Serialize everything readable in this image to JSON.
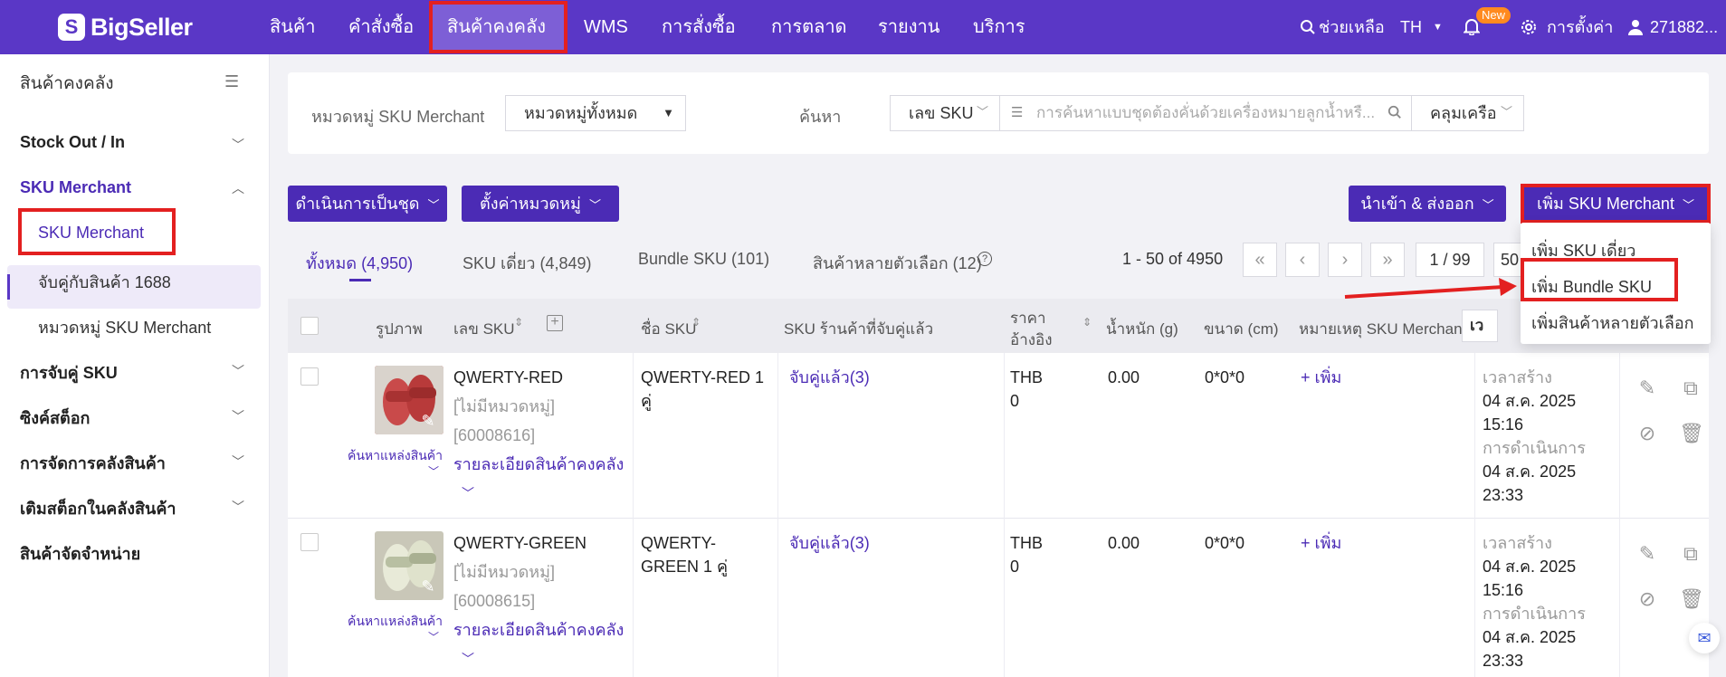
{
  "brand": {
    "name": "BigSeller",
    "mark": "S"
  },
  "topnav": {
    "items": [
      "สินค้า",
      "คำสั่งซื้อ",
      "สินค้าคงคลัง",
      "WMS",
      "การสั่งซื้อ",
      "การตลาด",
      "รายงาน",
      "บริการ"
    ],
    "active": "สินค้าคงคลัง"
  },
  "topright": {
    "help": "ช่วยเหลือ",
    "lang": "TH",
    "badge": "New",
    "settings": "การตั้งค่า",
    "user": "271882..."
  },
  "sidebar": {
    "title": "สินค้าคงคลัง",
    "groups": [
      {
        "label": "Stock Out / In"
      },
      {
        "label": "SKU Merchant"
      },
      {
        "label": "การจับคู่ SKU"
      },
      {
        "label": "ซิงค์สต็อก"
      },
      {
        "label": "การจัดการคลังสินค้า"
      },
      {
        "label": "เติมสต็อกในคลังสินค้า"
      },
      {
        "label": "สินค้าจัดจำหน่าย"
      }
    ],
    "subitems": [
      "SKU Merchant",
      "จับคู่กับสินค้า 1688",
      "หมวดหมู่ SKU Merchant"
    ]
  },
  "filters": {
    "category_label": "หมวดหมู่ SKU Merchant",
    "category_value": "หมวดหมู่ทั้งหมด",
    "search_label": "ค้นหา",
    "search_field": "เลข SKU",
    "search_placeholder": "การค้นหาแบบชุดต้องคั่นด้วยเครื่องหมายลูกน้ำหรื...",
    "match_mode": "คลุมเครือ"
  },
  "toolbar": {
    "bulk": "ดำเนินการเป็นชุด",
    "set_category": "ตั้งค่าหมวดหมู่",
    "import_export": "นำเข้า & ส่งออก",
    "add_sku": "เพิ่ม SKU Merchant"
  },
  "dropdown": {
    "items": [
      "เพิ่ม SKU เดี่ยว",
      "เพิ่ม Bundle SKU",
      "เพิ่มสินค้าหลายตัวเลือก"
    ]
  },
  "tabs": [
    "ทั้งหมด (4,950)",
    "SKU เดี่ยว (4,849)",
    "Bundle SKU (101)",
    "สินค้าหลายตัวเลือก (12)"
  ],
  "pagination": {
    "range": "1 - 50 of 4950",
    "page": "1 / 99",
    "size": "50"
  },
  "table": {
    "headers": {
      "image": "รูปภาพ",
      "sku": "เลข SKU",
      "name": "ชื่อ SKU",
      "store_sku": "SKU ร้านค้าที่จับคู่แล้ว",
      "price1": "ราคา",
      "price2": "อ้างอิง",
      "weight": "น้ำหนัก (g)",
      "size": "ขนาด (cm)",
      "note": "หมายเหตุ SKU Merchant",
      "time_sort": "เว"
    },
    "rows": [
      {
        "sku": "QWERTY-RED",
        "category": "[ไม่มีหมวดหมู่]",
        "id": "[60008616]",
        "detail_link": "รายละเอียดสินค้าคงคลัง",
        "source_link": "ค้นหาแหล่งสินค้า",
        "name_1": "QWERTY-RED 1",
        "name_2": "คู่",
        "matched": "จับคู่แล้ว(3)",
        "currency": "THB",
        "price": "0",
        "weight": "0.00",
        "size": "0*0*0",
        "note_add": "+ เพิ่ม",
        "created_label": "เวลาสร้าง",
        "created_date": "04 ส.ค. 2025",
        "created_time": "15:16",
        "updated_label": "การดำเนินการ",
        "updated_date": "04 ส.ค. 2025",
        "updated_time": "23:33",
        "thumb_color": "#c94a4a"
      },
      {
        "sku": "QWERTY-GREEN",
        "category": "[ไม่มีหมวดหมู่]",
        "id": "[60008615]",
        "detail_link": "รายละเอียดสินค้าคงคลัง",
        "source_link": "ค้นหาแหล่งสินค้า",
        "name_1": "QWERTY-",
        "name_2": "GREEN 1 คู่",
        "matched": "จับคู่แล้ว(3)",
        "currency": "THB",
        "price": "0",
        "weight": "0.00",
        "size": "0*0*0",
        "note_add": "+ เพิ่ม",
        "created_label": "เวลาสร้าง",
        "created_date": "04 ส.ค. 2025",
        "created_time": "15:16",
        "updated_label": "การดำเนินการ",
        "updated_date": "04 ส.ค. 2025",
        "updated_time": "23:33",
        "thumb_color": "#b8bfa2"
      }
    ]
  },
  "colors": {
    "primary": "#5a37c6",
    "button": "#4b2bb5",
    "annotation": "#e32020"
  }
}
